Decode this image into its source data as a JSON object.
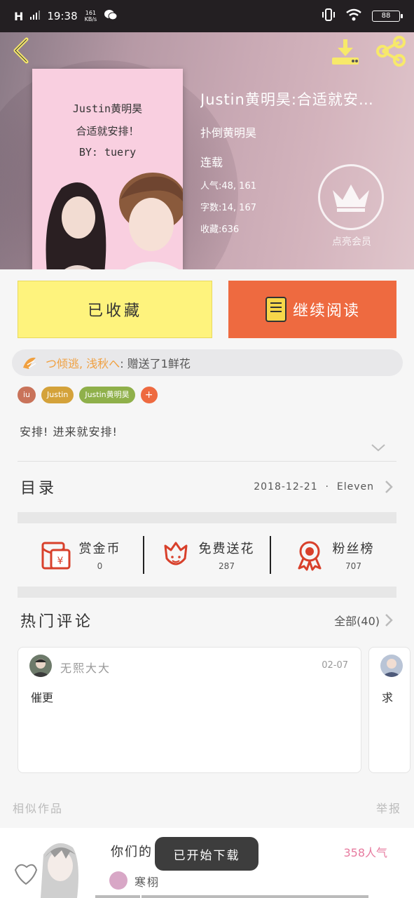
{
  "status_bar": {
    "time": "19:38",
    "signal": "H",
    "speed_top": "161",
    "speed_bottom": "KB/s",
    "battery": "88"
  },
  "book": {
    "title": "Justin黄明昊:合适就安…",
    "author": "扑倒黄明昊",
    "status": "连载",
    "popularity": "人气:48, 161",
    "word_count": "字数:14, 167",
    "favorites": "收藏:636",
    "cover_line1": "Justin黄明昊",
    "cover_line2": "合适就安排！",
    "cover_line3": "BY: tuery"
  },
  "vip": {
    "label": "点亮会员"
  },
  "actions": {
    "fav_label": "已收藏",
    "read_label": "继续阅读"
  },
  "gift": {
    "sender": "つ倾逃, 浅秋へ",
    "message": ": 赠送了1鲜花"
  },
  "tags": [
    {
      "label": "iu",
      "color": "#c9735a"
    },
    {
      "label": "Justin",
      "color": "#d4a23a"
    },
    {
      "label": "Justin黄明昊",
      "color": "#8fb04a"
    },
    {
      "label": "+",
      "color": "#ee6a40"
    }
  ],
  "description": "安排! 进来就安排!",
  "toc": {
    "label": "目录",
    "date": "2018-12-21",
    "chapter": "Eleven"
  },
  "rewards": [
    {
      "label": "赏金币",
      "count": "0"
    },
    {
      "label": "免费送花",
      "count": "287"
    },
    {
      "label": "粉丝榜",
      "count": "707"
    }
  ],
  "comments_section": {
    "title": "热门评论",
    "all_label": "全部(40)"
  },
  "comments": [
    {
      "user": "无熙大大",
      "date": "02-07",
      "text": "催更"
    },
    {
      "user": "",
      "date": "",
      "text": "求"
    }
  ],
  "similar": {
    "label": "相似作品",
    "report": "举报"
  },
  "recommend": {
    "title": "你们的",
    "popularity": "358人气",
    "author": "寒栩"
  },
  "toast": "已开始下载",
  "colors": {
    "accent_orange": "#ee6a40",
    "fav_yellow": "#fef37d",
    "pink": "#e77b9f"
  }
}
